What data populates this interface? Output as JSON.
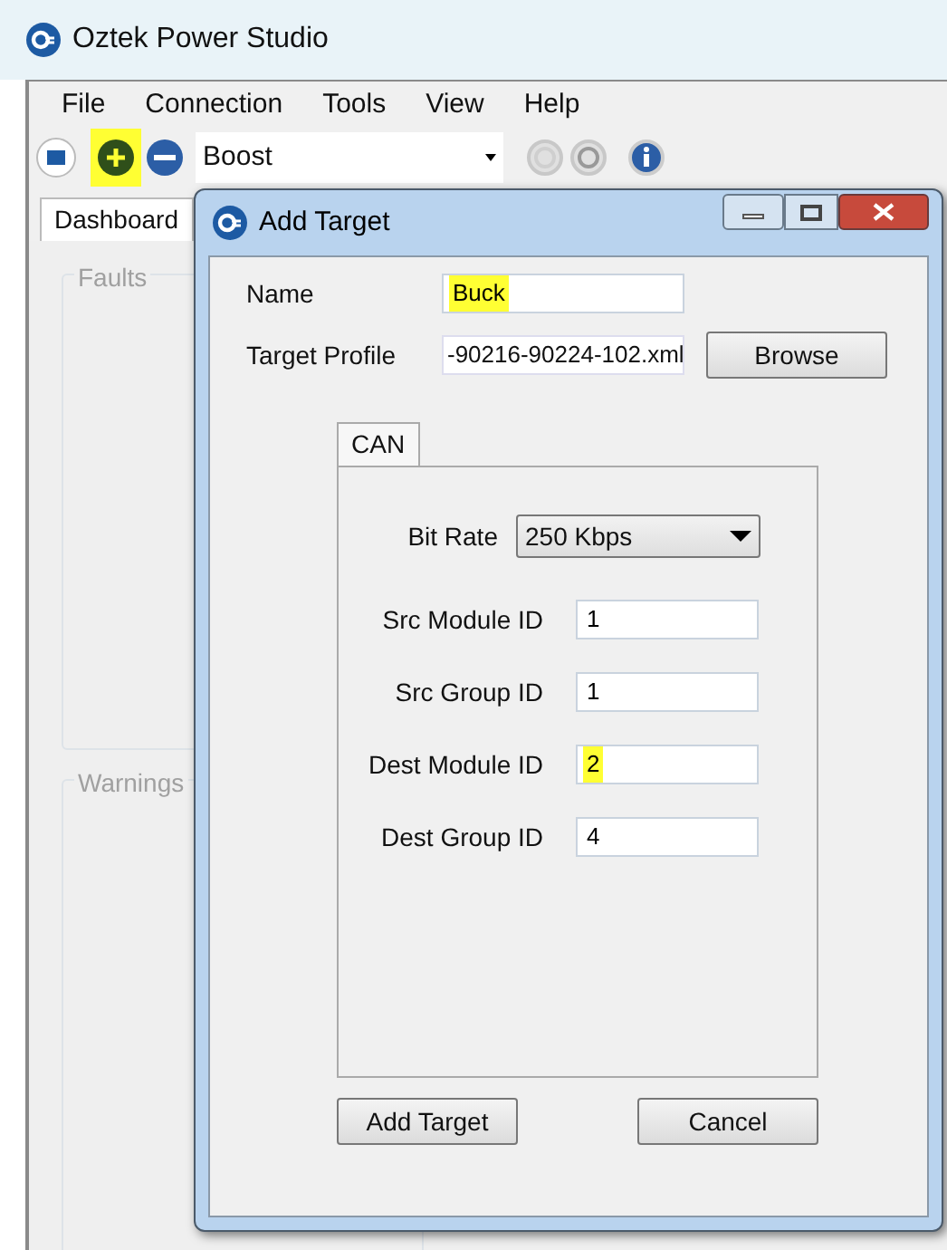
{
  "window": {
    "title": "Oztek Power Studio"
  },
  "menu": [
    "File",
    "Connection",
    "Tools",
    "View",
    "Help"
  ],
  "toolbar": {
    "add_highlighted": true,
    "profile": "Boost"
  },
  "tabs": [
    {
      "label": "Dashboard",
      "selected": true
    }
  ],
  "groups": [
    {
      "title": "Faults"
    },
    {
      "title": "Warnings"
    }
  ],
  "dialog": {
    "title": "Add Target",
    "name": {
      "label": "Name",
      "value": "Buck",
      "highlighted": true
    },
    "profile": {
      "label": "Target Profile",
      "value": "-90216-90224-102.xml",
      "button": "Browse"
    },
    "tabs": [
      {
        "label": "CAN",
        "selected": true
      }
    ],
    "bit_rate": {
      "label": "Bit Rate",
      "value": "250 Kbps"
    },
    "fields": [
      {
        "label": "Src Module ID",
        "value": "1",
        "highlighted": false
      },
      {
        "label": "Src Group ID",
        "value": "1",
        "highlighted": false
      },
      {
        "label": "Dest Module ID",
        "value": "2",
        "highlighted": true
      },
      {
        "label": "Dest Group ID",
        "value": "4",
        "highlighted": false
      }
    ],
    "buttons": [
      "Add Target",
      "Cancel"
    ]
  }
}
